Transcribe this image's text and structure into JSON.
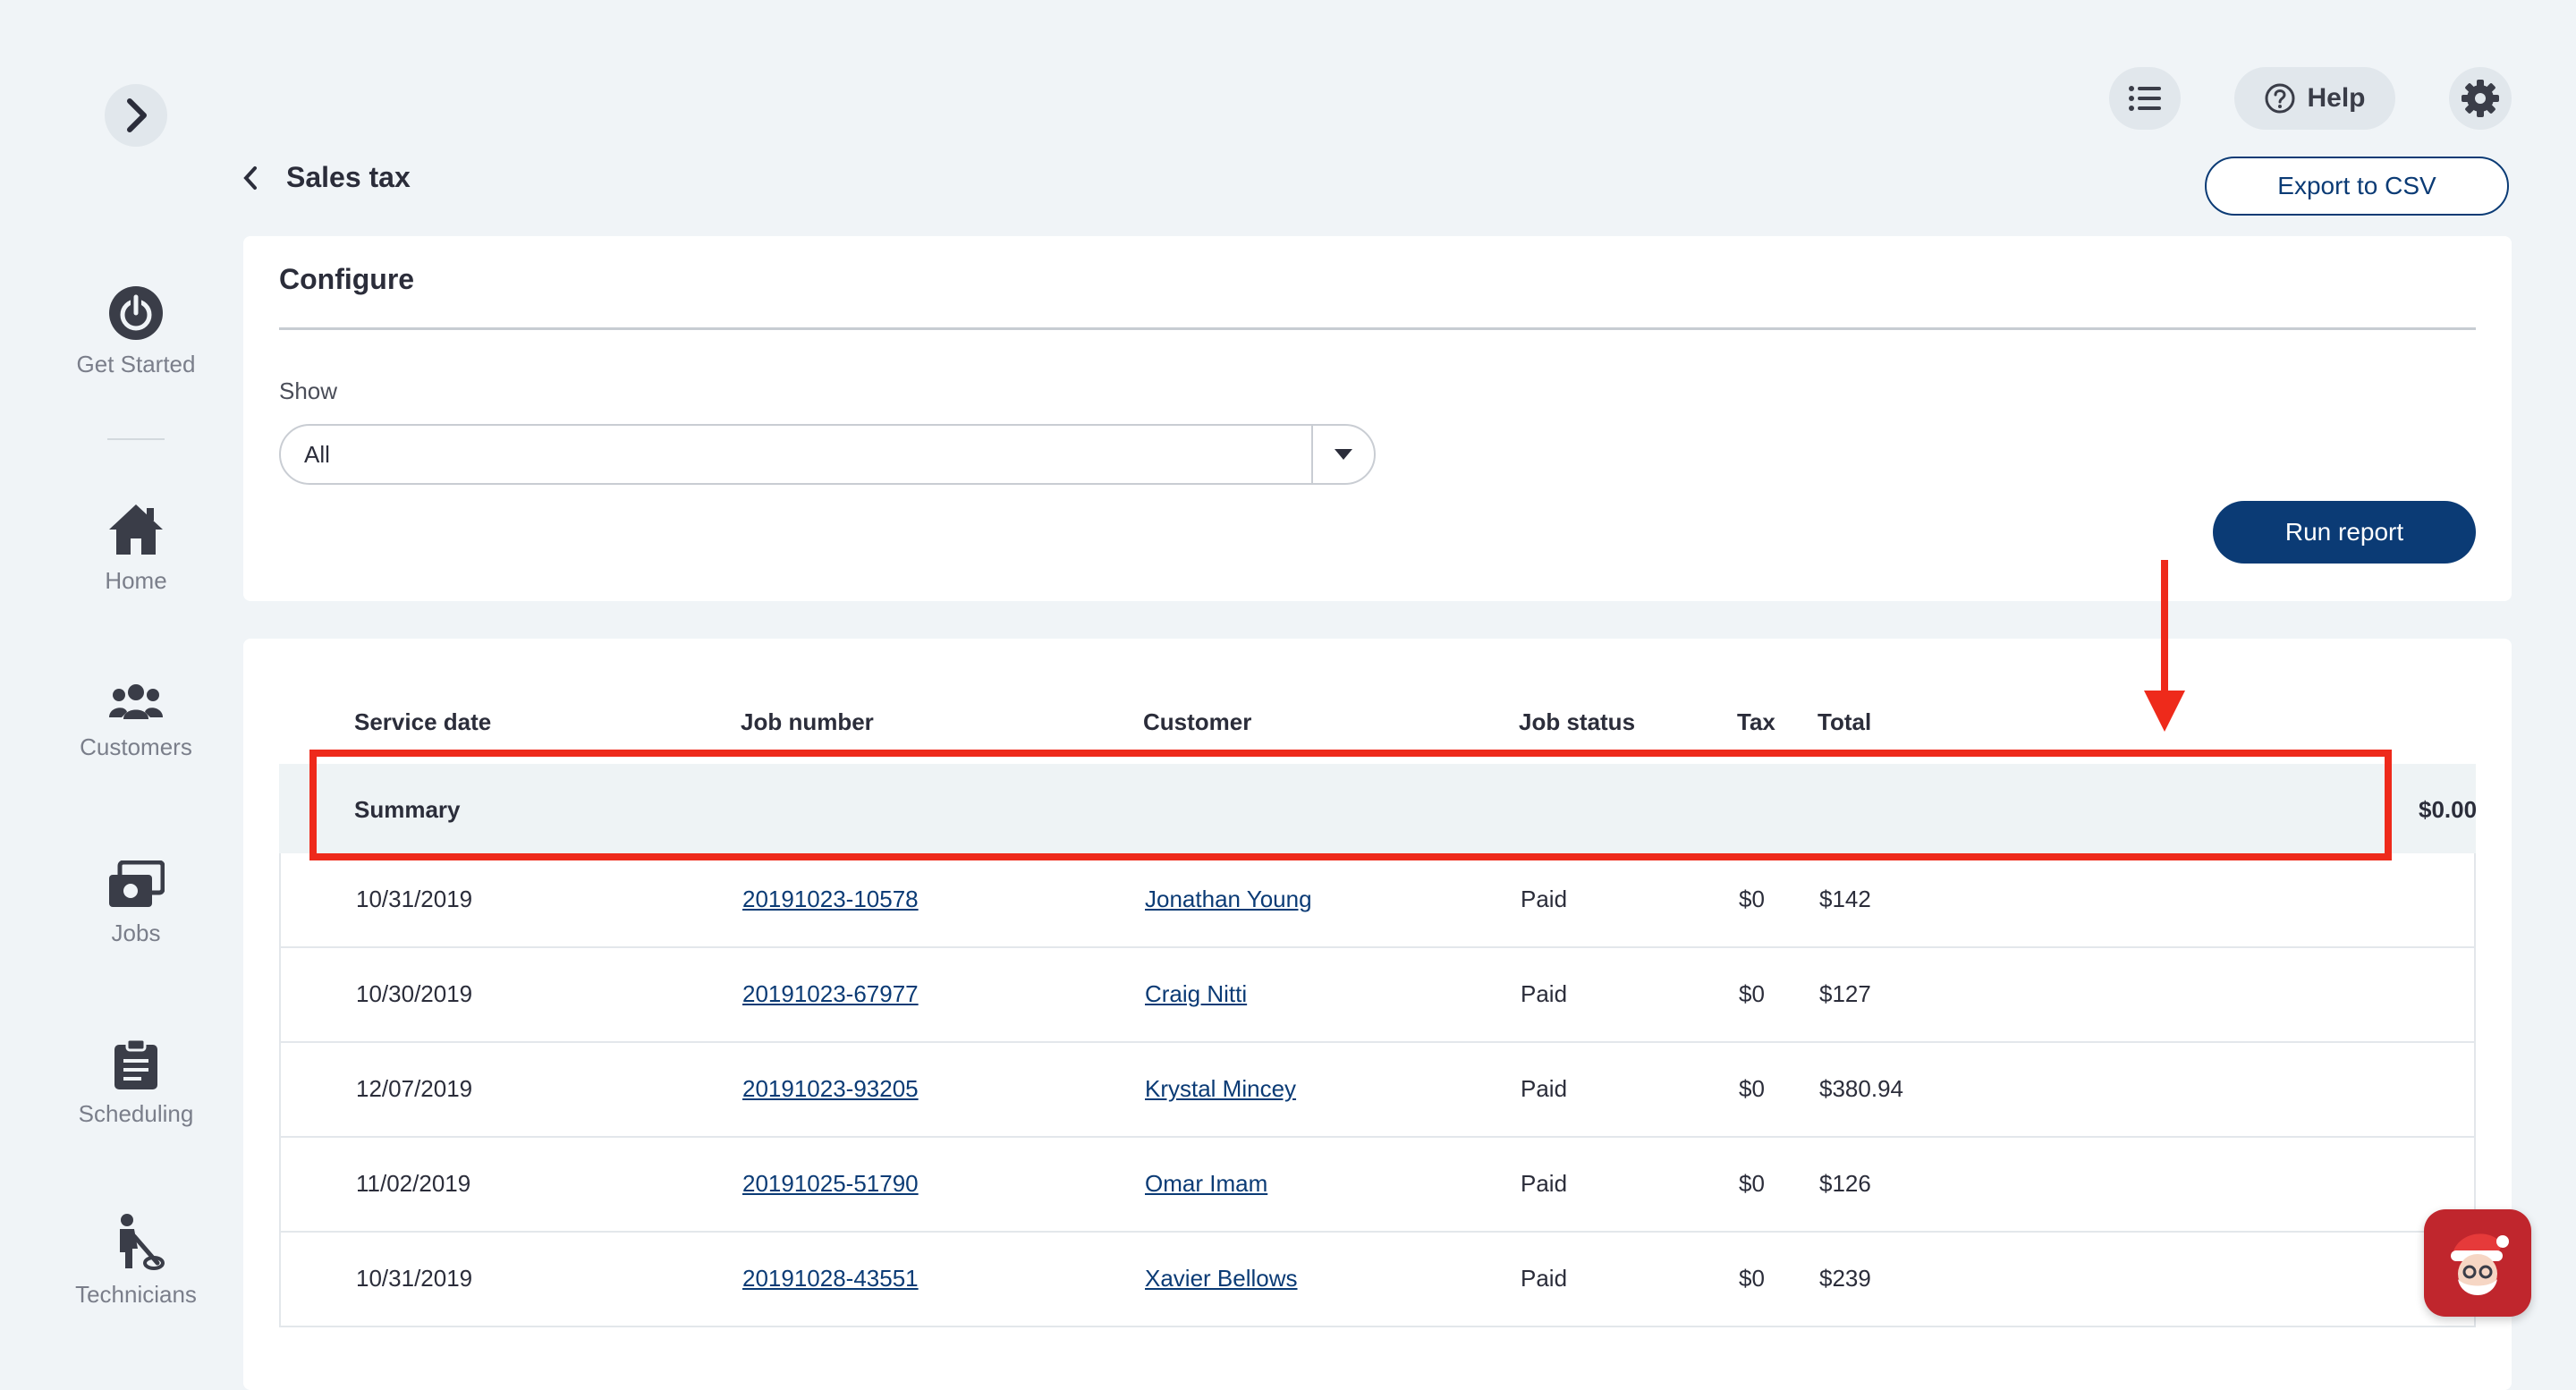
{
  "sidebar": {
    "items": [
      {
        "label": "Get Started",
        "icon": "power-icon"
      },
      {
        "label": "Home",
        "icon": "home-icon"
      },
      {
        "label": "Customers",
        "icon": "users-icon"
      },
      {
        "label": "Jobs",
        "icon": "jobs-icon"
      },
      {
        "label": "Scheduling",
        "icon": "clipboard-icon"
      },
      {
        "label": "Technicians",
        "icon": "technician-icon"
      }
    ]
  },
  "topbar": {
    "help_label": "Help"
  },
  "page": {
    "title": "Sales tax",
    "export_label": "Export to CSV"
  },
  "configure": {
    "title": "Configure",
    "show_label": "Show",
    "show_value": "All",
    "run_label": "Run report"
  },
  "table": {
    "headers": [
      "Service date",
      "Job number",
      "Customer",
      "Job status",
      "Tax",
      "Total"
    ],
    "summary": {
      "label": "Summary",
      "value": "$0.00"
    },
    "rows": [
      {
        "date": "10/31/2019",
        "job": "20191023-10578",
        "customer": "Jonathan Young",
        "status": "Paid",
        "tax": "$0",
        "total": "$142"
      },
      {
        "date": "10/30/2019",
        "job": "20191023-67977",
        "customer": "Craig Nitti",
        "status": "Paid",
        "tax": "$0",
        "total": "$127"
      },
      {
        "date": "12/07/2019",
        "job": "20191023-93205",
        "customer": "Krystal Mincey",
        "status": "Paid",
        "tax": "$0",
        "total": "$380.94"
      },
      {
        "date": "11/02/2019",
        "job": "20191025-51790",
        "customer": "Omar Imam",
        "status": "Paid",
        "tax": "$0",
        "total": "$126"
      },
      {
        "date": "10/31/2019",
        "job": "20191028-43551",
        "customer": "Xavier Bellows",
        "status": "Paid",
        "tax": "$0",
        "total": "$239"
      }
    ]
  },
  "colors": {
    "accent": "#0b3b75",
    "highlight": "#ee2a1b",
    "background": "#f0f4f7"
  }
}
